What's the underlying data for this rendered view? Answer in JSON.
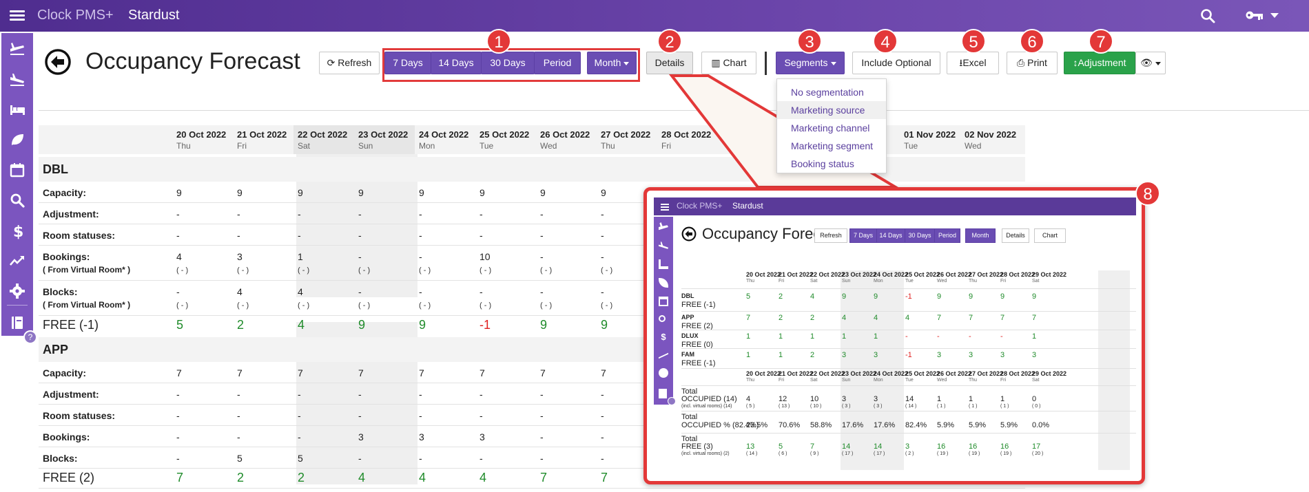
{
  "app": {
    "brand": "Clock PMS+",
    "hotel": "Stardust"
  },
  "page": {
    "title": "Occupancy Forecast"
  },
  "colors": {
    "brand_purple": "#6a4db3",
    "green": "#2aa24a",
    "annotation_red": "#e33838",
    "value_green": "#1f8b2a",
    "value_red": "#e02020"
  },
  "toolbar": {
    "refresh": "Refresh",
    "days7": "7 Days",
    "days14": "14 Days",
    "days30": "30 Days",
    "period": "Period",
    "month": "Month",
    "details": "Details",
    "chart": "Chart",
    "segments": "Segments",
    "include_optional": "Include Optional",
    "excel": "Excel",
    "print": "Print",
    "adjustment": "Adjustment"
  },
  "badges": [
    "1",
    "2",
    "3",
    "4",
    "5",
    "6",
    "7",
    "8"
  ],
  "segments_menu": [
    "No segmentation",
    "Marketing source",
    "Marketing channel",
    "Marketing segment",
    "Booking status"
  ],
  "dates": [
    {
      "d": "20 Oct 2022",
      "w": "Thu"
    },
    {
      "d": "21 Oct 2022",
      "w": "Fri"
    },
    {
      "d": "22 Oct 2022",
      "w": "Sat"
    },
    {
      "d": "23 Oct 2022",
      "w": "Sun"
    },
    {
      "d": "24 Oct 2022",
      "w": "Mon"
    },
    {
      "d": "25 Oct 2022",
      "w": "Tue"
    },
    {
      "d": "26 Oct 2022",
      "w": "Wed"
    },
    {
      "d": "27 Oct 2022",
      "w": "Thu"
    },
    {
      "d": "28 Oct 2022",
      "w": "Fri"
    }
  ],
  "dates_right": [
    {
      "d": "01 Nov 2022",
      "w": "Tue"
    },
    {
      "d": "02 Nov 2022",
      "w": "Wed"
    }
  ],
  "labels": {
    "capacity": "Capacity:",
    "adjustment": "Adjustment:",
    "room_statuses": "Room statuses:",
    "bookings": "Bookings:",
    "blocks": "Blocks:",
    "from_virtual": "( From Virtual Room* )"
  },
  "groups": {
    "dbl": {
      "name": "DBL",
      "capacity": [
        "9",
        "9",
        "9",
        "9",
        "9",
        "9",
        "9",
        "9"
      ],
      "adjustment": [
        "-",
        "-",
        "-",
        "-",
        "-",
        "-",
        "-",
        "-"
      ],
      "room_statuses": [
        "-",
        "-",
        "-",
        "-",
        "-",
        "-",
        "-",
        "-"
      ],
      "bookings": [
        "4",
        "3",
        "1",
        "-",
        "-",
        "10",
        "-",
        "-"
      ],
      "bookings_virtual": [
        "( - )",
        "( - )",
        "( - )",
        "( - )",
        "( - )",
        "( - )",
        "( - )",
        "( - )"
      ],
      "blocks": [
        "-",
        "4",
        "4",
        "-",
        "-",
        "-",
        "-",
        "-"
      ],
      "blocks_virtual": [
        "( - )",
        "( - )",
        "( - )",
        "( - )",
        "( - )",
        "( - )",
        "( - )",
        "( - )"
      ],
      "free_label": "FREE (-1)",
      "free": [
        "5",
        "2",
        "4",
        "9",
        "9",
        "-1",
        "9",
        "9"
      ]
    },
    "app": {
      "name": "APP",
      "capacity": [
        "7",
        "7",
        "7",
        "7",
        "7",
        "7",
        "7",
        "7"
      ],
      "adjustment": [
        "-",
        "-",
        "-",
        "-",
        "-",
        "-",
        "-",
        "-"
      ],
      "room_statuses": [
        "-",
        "-",
        "-",
        "-",
        "-",
        "-",
        "-",
        "-"
      ],
      "bookings": [
        "-",
        "-",
        "-",
        "3",
        "3",
        "3",
        "-",
        "-"
      ],
      "blocks": [
        "-",
        "5",
        "5",
        "-",
        "-",
        "-",
        "-",
        "-"
      ],
      "free_label": "FREE (2)",
      "free": [
        "7",
        "2",
        "2",
        "4",
        "4",
        "4",
        "7",
        "7"
      ]
    }
  },
  "inset": {
    "title": "Occupancy Forecast",
    "buttons": [
      "Refresh",
      "7 Days",
      "14 Days",
      "30 Days",
      "Period",
      "Month",
      "Details",
      "Chart"
    ],
    "dates": [
      {
        "d": "20 Oct 2022",
        "w": "Thu"
      },
      {
        "d": "21 Oct 2022",
        "w": "Fri"
      },
      {
        "d": "22 Oct 2022",
        "w": "Sat"
      },
      {
        "d": "23 Oct 2022",
        "w": "Sun"
      },
      {
        "d": "24 Oct 2022",
        "w": "Mon"
      },
      {
        "d": "25 Oct 2022",
        "w": "Tue"
      },
      {
        "d": "26 Oct 2022",
        "w": "Wed"
      },
      {
        "d": "27 Oct 2022",
        "w": "Thu"
      },
      {
        "d": "28 Oct 2022",
        "w": "Fri"
      },
      {
        "d": "29 Oct 2022",
        "w": "Sat"
      }
    ],
    "rooms": [
      {
        "name": "DBL",
        "free": "FREE (-1)",
        "values": [
          "5",
          "2",
          "4",
          "9",
          "9",
          "-1",
          "9",
          "9",
          "9",
          "9"
        ]
      },
      {
        "name": "APP",
        "free": "FREE (2)",
        "values": [
          "7",
          "2",
          "2",
          "4",
          "4",
          "4",
          "7",
          "7",
          "7",
          "7"
        ]
      },
      {
        "name": "DLUX",
        "free": "FREE (0)",
        "values": [
          "1",
          "1",
          "1",
          "1",
          "1",
          "-",
          "-",
          "-",
          "-",
          "1"
        ]
      },
      {
        "name": "FAM",
        "free": "FREE (-1)",
        "values": [
          "1",
          "1",
          "2",
          "3",
          "3",
          "-1",
          "3",
          "3",
          "3",
          "3"
        ]
      }
    ],
    "total_label": "Total",
    "virtual_note": "(incl. virtual rooms)",
    "occupied": {
      "label": "OCCUPIED (14)",
      "note": "(incl. virtual rooms) (14)",
      "values": [
        "4",
        "12",
        "10",
        "3",
        "3",
        "14",
        "1",
        "1",
        "1",
        "0"
      ],
      "sub": [
        "( 5 )",
        "( 13 )",
        "( 10 )",
        "( 3 )",
        "( 3 )",
        "( 14 )",
        "( 1 )",
        "( 1 )",
        "( 1 )",
        "( 0 )"
      ]
    },
    "occupied_pct": {
      "label": "OCCUPIED % (82.4%)",
      "values": [
        "23.5%",
        "70.6%",
        "58.8%",
        "17.6%",
        "17.6%",
        "82.4%",
        "5.9%",
        "5.9%",
        "5.9%",
        "0.0%"
      ]
    },
    "free_total": {
      "label": "FREE (3)",
      "note": "(incl. virtual rooms) (2)",
      "values": [
        "13",
        "5",
        "7",
        "14",
        "14",
        "3",
        "16",
        "16",
        "16",
        "17"
      ],
      "sub": [
        "( 14 )",
        "( 6 )",
        "( 9 )",
        "( 17 )",
        "( 17 )",
        "( 2 )",
        "( 19 )",
        "( 19 )",
        "( 19 )",
        "( 20 )"
      ]
    }
  }
}
